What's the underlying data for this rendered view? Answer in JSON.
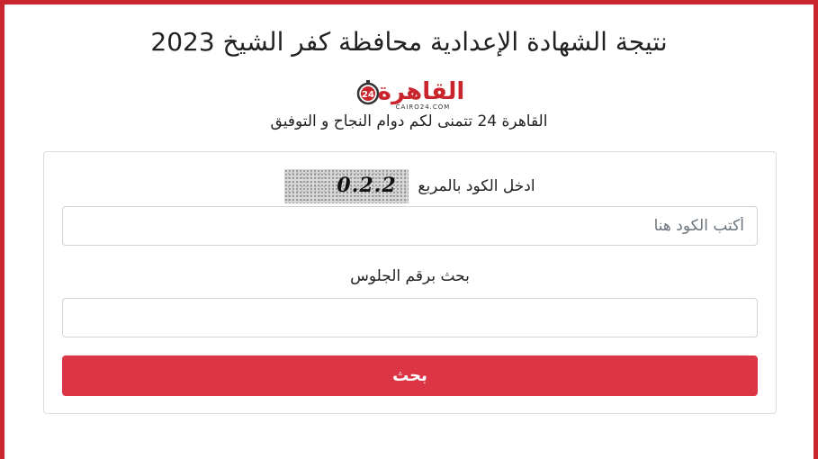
{
  "page": {
    "title": "نتيجة الشهادة الإعدادية محافظة كفر الشيخ  2023",
    "subtitle": "القاهرة 24 تتمنى لكم دوام النجاح و التوفيق"
  },
  "logo": {
    "text": "القاهرة",
    "badge": "24",
    "domain": "CAIRO24.COM",
    "brand_color": "#c9252c"
  },
  "form": {
    "captcha_label": "ادخل الكود بالمربع",
    "captcha_text": "0.2.2",
    "code_placeholder": "أكتب الكود هنا",
    "seat_label": "بحث برقم الجلوس",
    "seat_value": "",
    "submit_label": "بحث",
    "submit_color": "#dc3545"
  }
}
